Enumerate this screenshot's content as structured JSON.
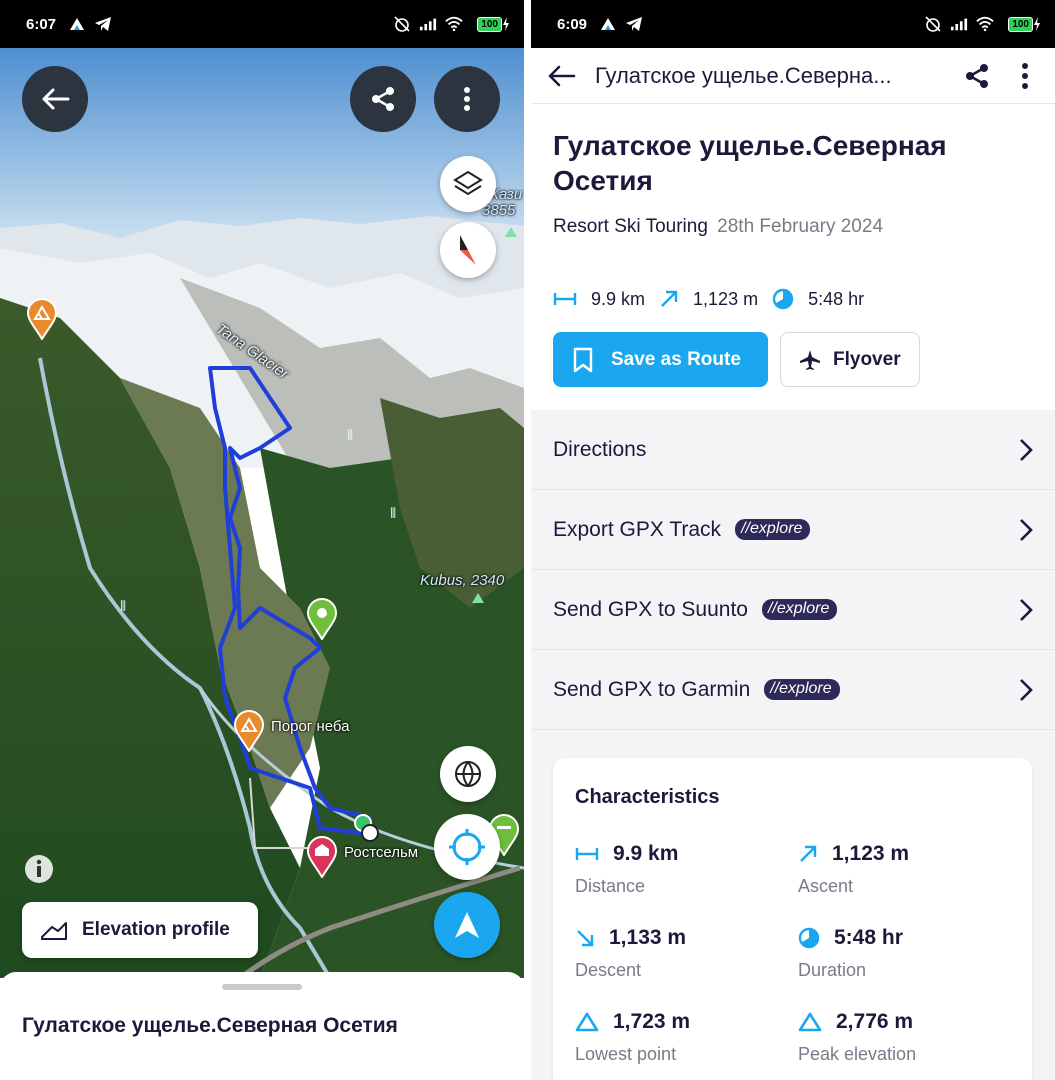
{
  "left": {
    "status": {
      "time": "6:07",
      "battery": "100"
    },
    "map_labels": {
      "glacier": "Tana Glacier",
      "kubus": "Kubus, 2340",
      "peak_partial_name": "Кази",
      "peak_partial_elev": "3855",
      "porog": "Порог неба",
      "rostselmash": "Ростсельм"
    },
    "elevation_button": "Elevation profile",
    "sheet_title": "Гулатское ущелье.Северная Осетия"
  },
  "right": {
    "status": {
      "time": "6:09",
      "battery": "100"
    },
    "appbar_title": "Гулатское ущелье.Северна...",
    "title": "Гулатское ущелье.Северная Осетия",
    "activity": "Resort Ski Touring",
    "date": "28th February 2024",
    "stats": {
      "distance": "9.9 km",
      "ascent": "1,123 m",
      "duration": "5:48 hr"
    },
    "save_button": "Save as Route",
    "flyover_button": "Flyover",
    "menu": [
      {
        "label": "Directions",
        "tag": ""
      },
      {
        "label": "Export GPX Track",
        "tag": "explore"
      },
      {
        "label": "Send GPX to Suunto",
        "tag": "explore"
      },
      {
        "label": "Send GPX to Garmin",
        "tag": "explore"
      }
    ],
    "characteristics": {
      "heading": "Characteristics",
      "items": [
        {
          "value": "9.9 km",
          "label": "Distance",
          "icon": "distance-icon"
        },
        {
          "value": "1,123 m",
          "label": "Ascent",
          "icon": "ascent-icon"
        },
        {
          "value": "1,133 m",
          "label": "Descent",
          "icon": "descent-icon"
        },
        {
          "value": "5:48 hr",
          "label": "Duration",
          "icon": "duration-icon"
        },
        {
          "value": "1,723 m",
          "label": "Lowest point",
          "icon": "lowest-point-icon"
        },
        {
          "value": "2,776 m",
          "label": "Peak elevation",
          "icon": "peak-elevation-icon"
        }
      ]
    }
  },
  "colors": {
    "accent": "#1aa7ef",
    "text": "#1c1a3b",
    "tag": "#2d2a5a",
    "route": "#1f3fd8"
  }
}
